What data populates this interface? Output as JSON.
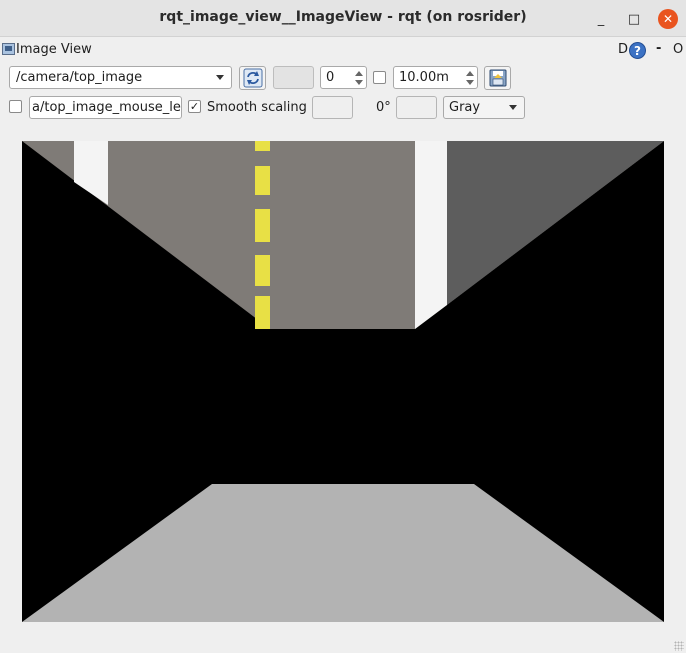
{
  "window": {
    "title": "rqt_image_view__ImageView - rqt (on rosrider)",
    "minimize_glyph": "_",
    "maximize_glyph": "□",
    "close_glyph": "✕"
  },
  "plugin": {
    "title": "Image View",
    "d_label": "D",
    "help_label": "?",
    "dash_label": "-",
    "o_label": "O"
  },
  "controls": {
    "topic": "/camera/top_image",
    "spin_value": "0",
    "time_value": "10.00m",
    "publish_checked": false,
    "mouse_topic": "a/top_image_mouse_left",
    "smooth_scaling_checked": true,
    "smooth_scaling_label": "Smooth scaling",
    "rotation_label": "0°",
    "colormap": "Gray",
    "check_glyph": "✓"
  },
  "icons": [
    "refresh-icon",
    "save-icon",
    "help-icon",
    "image-view-icon",
    "close-icon"
  ],
  "colors": {
    "close_button": "#e9541f",
    "road": "#7f7b77",
    "lane_dash": "#e8e045",
    "floor": "#b3b3b3"
  }
}
